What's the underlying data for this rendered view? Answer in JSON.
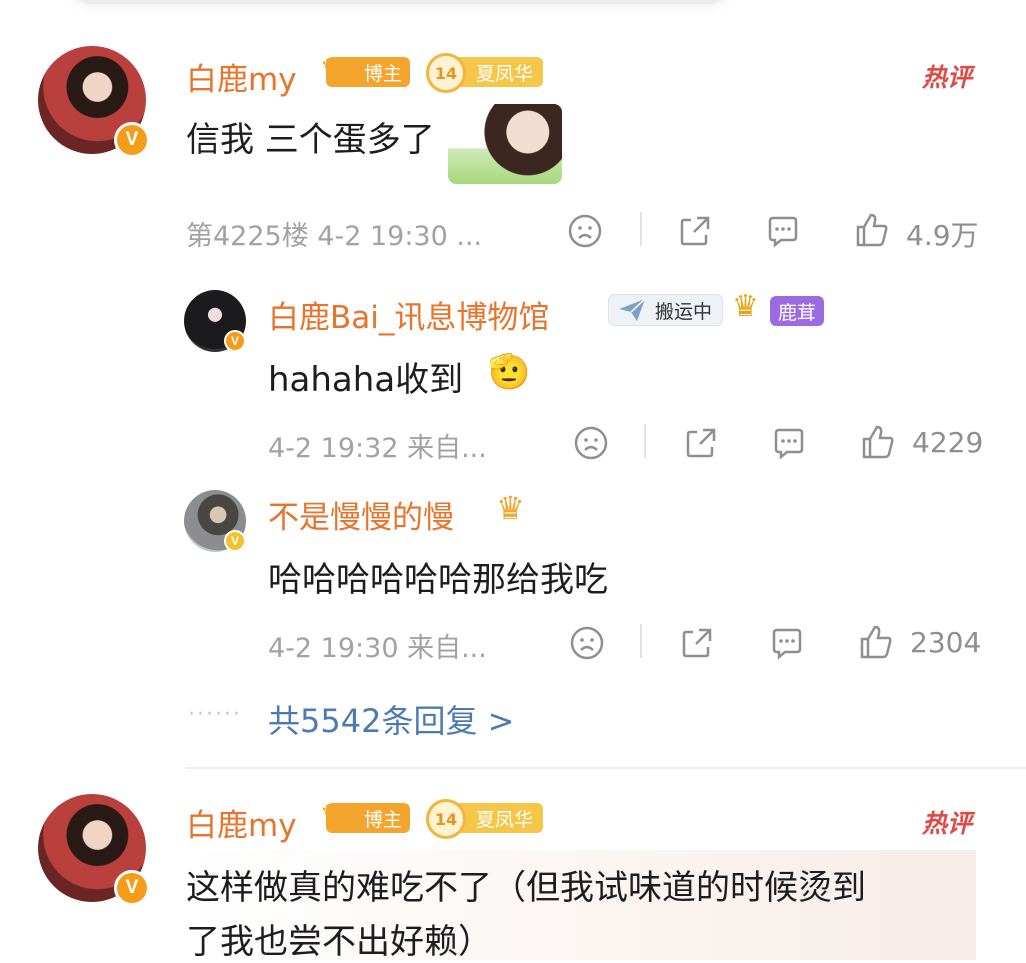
{
  "comments": [
    {
      "user": "白鹿my",
      "badges": [
        "博主",
        "14",
        "夏凤华"
      ],
      "hot_label": "热评",
      "text": "信我 三个蛋多了",
      "meta": "第4225楼 4-2 19:30 ...",
      "likes": "4.9万",
      "avatar_badge": "V"
    },
    {
      "user": "白鹿my",
      "badges": [
        "博主",
        "14",
        "夏凤华"
      ],
      "hot_label": "热评",
      "text_line1": "这样做真的难吃不了（但我试味道的时候烫到",
      "text_line2": "了我也尝不出好赖）",
      "avatar_badge": "V"
    }
  ],
  "replies": [
    {
      "user": "白鹿Bai_讯息博物馆",
      "badges": [
        "搬运中",
        "鹿茸"
      ],
      "text": "hahaha收到",
      "meta": "4-2 19:32 来自...",
      "likes": "4229",
      "avatar_badge": "V"
    },
    {
      "user": "不是慢慢的慢",
      "text": "哈哈哈哈哈哈那给我吃",
      "meta": "4-2 19:30 来自...",
      "likes": "2304",
      "avatar_badge": "V"
    }
  ],
  "more_replies": "共5542条回复 >",
  "icons": {
    "dislike": "sad-face-icon",
    "share": "share-icon",
    "comment": "comment-icon",
    "like": "thumbs-up-icon"
  },
  "colors": {
    "username": "#e8742c",
    "link": "#4c7bb3",
    "hot": "#e04a45",
    "verified": "#f59d1a"
  }
}
